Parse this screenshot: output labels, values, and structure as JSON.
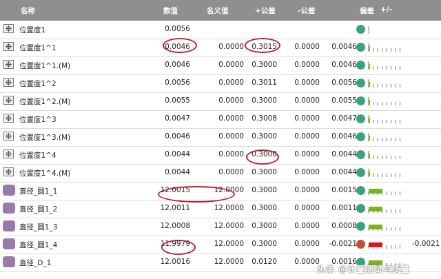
{
  "headers": {
    "name": "名称",
    "value": "数值",
    "nominal": "名义值",
    "plus_tol": "+公差",
    "minus_tol": "-公差",
    "deviation": "偏差",
    "pm": "+/-"
  },
  "rows": [
    {
      "name": "位置度1",
      "value": "0.0056",
      "nominal": "",
      "plus": "",
      "minus": "",
      "dev": "",
      "status": "ok",
      "bar": "none",
      "icon": "position"
    },
    {
      "name": "位置度1^1",
      "value": "0.0046",
      "nominal": "0.0000",
      "plus": "0.3015",
      "minus": "0.0000",
      "dev": "0.0046",
      "status": "ok",
      "bar": "ticks",
      "icon": "position"
    },
    {
      "name": "位置度1^1.(M)",
      "value": "0.0046",
      "nominal": "0.0000",
      "plus": "0.3000",
      "minus": "0.0000",
      "dev": "0.0046",
      "status": "ok",
      "bar": "ticks",
      "icon": "position"
    },
    {
      "name": "位置度1^2",
      "value": "0.0056",
      "nominal": "0.0000",
      "plus": "0.3011",
      "minus": "0.0000",
      "dev": "0.0056",
      "status": "ok",
      "bar": "ticks",
      "icon": "position"
    },
    {
      "name": "位置度1^2.(M)",
      "value": "0.0055",
      "nominal": "0.0000",
      "plus": "0.3000",
      "minus": "0.0000",
      "dev": "0.0055",
      "status": "ok",
      "bar": "ticks",
      "icon": "position"
    },
    {
      "name": "位置度1^3",
      "value": "0.0047",
      "nominal": "0.0000",
      "plus": "0.3008",
      "minus": "0.0000",
      "dev": "0.0047",
      "status": "ok",
      "bar": "ticks",
      "icon": "position"
    },
    {
      "name": "位置度1^3.(M)",
      "value": "0.0046",
      "nominal": "0.0000",
      "plus": "0.3000",
      "minus": "0.0000",
      "dev": "0.0046",
      "status": "ok",
      "bar": "ticks",
      "icon": "position"
    },
    {
      "name": "位置度1^4",
      "value": "0.0044",
      "nominal": "0.0000",
      "plus": "0.3000",
      "minus": "0.0000",
      "dev": "0.0044",
      "status": "ok",
      "bar": "ticks",
      "icon": "position"
    },
    {
      "name": "位置度1^4.(M)",
      "value": "0.0044",
      "nominal": "0.0000",
      "plus": "0.3000",
      "minus": "0.0000",
      "dev": "0.0044",
      "status": "ok",
      "bar": "ticks",
      "icon": "position"
    },
    {
      "name": "直径_圆1_1",
      "value": "12.0015",
      "nominal": "12.0000",
      "plus": "0.3000",
      "minus": "0.0000",
      "dev": "0.0015",
      "status": "ok",
      "bar": "green",
      "icon": "diameter"
    },
    {
      "name": "直径_圆1_2",
      "value": "12.0011",
      "nominal": "12.0000",
      "plus": "0.3000",
      "minus": "0.0000",
      "dev": "0.0011",
      "status": "ok",
      "bar": "green",
      "icon": "diameter"
    },
    {
      "name": "直径_圆1_3",
      "value": "12.0008",
      "nominal": "12.0000",
      "plus": "0.3000",
      "minus": "0.0000",
      "dev": "0.0008",
      "status": "ok",
      "bar": "green",
      "icon": "diameter"
    },
    {
      "name": "直径_圆1_4",
      "value": "11.9979",
      "nominal": "12.0000",
      "plus": "0.3000",
      "minus": "0.0000",
      "dev": "-0.0021",
      "status": "bad",
      "bar": "red",
      "icon": "diameter",
      "side_value": "-0.0021"
    },
    {
      "name": "直径_D_1",
      "value": "12.0016",
      "nominal": "12.0000",
      "plus": "0.0120",
      "minus": "0.0000",
      "dev": "0.0016",
      "status": "ok",
      "bar": "green",
      "icon": "diameter"
    }
  ],
  "colors": {
    "header_bg": "#8f8f8f",
    "ok": "#3aa37a",
    "bad": "#c0503a",
    "bar_green": "#7ab51d",
    "bar_red": "#d8131b",
    "highlight": "#b8232f"
  },
  "watermark": "头条 @计量测试与质量"
}
